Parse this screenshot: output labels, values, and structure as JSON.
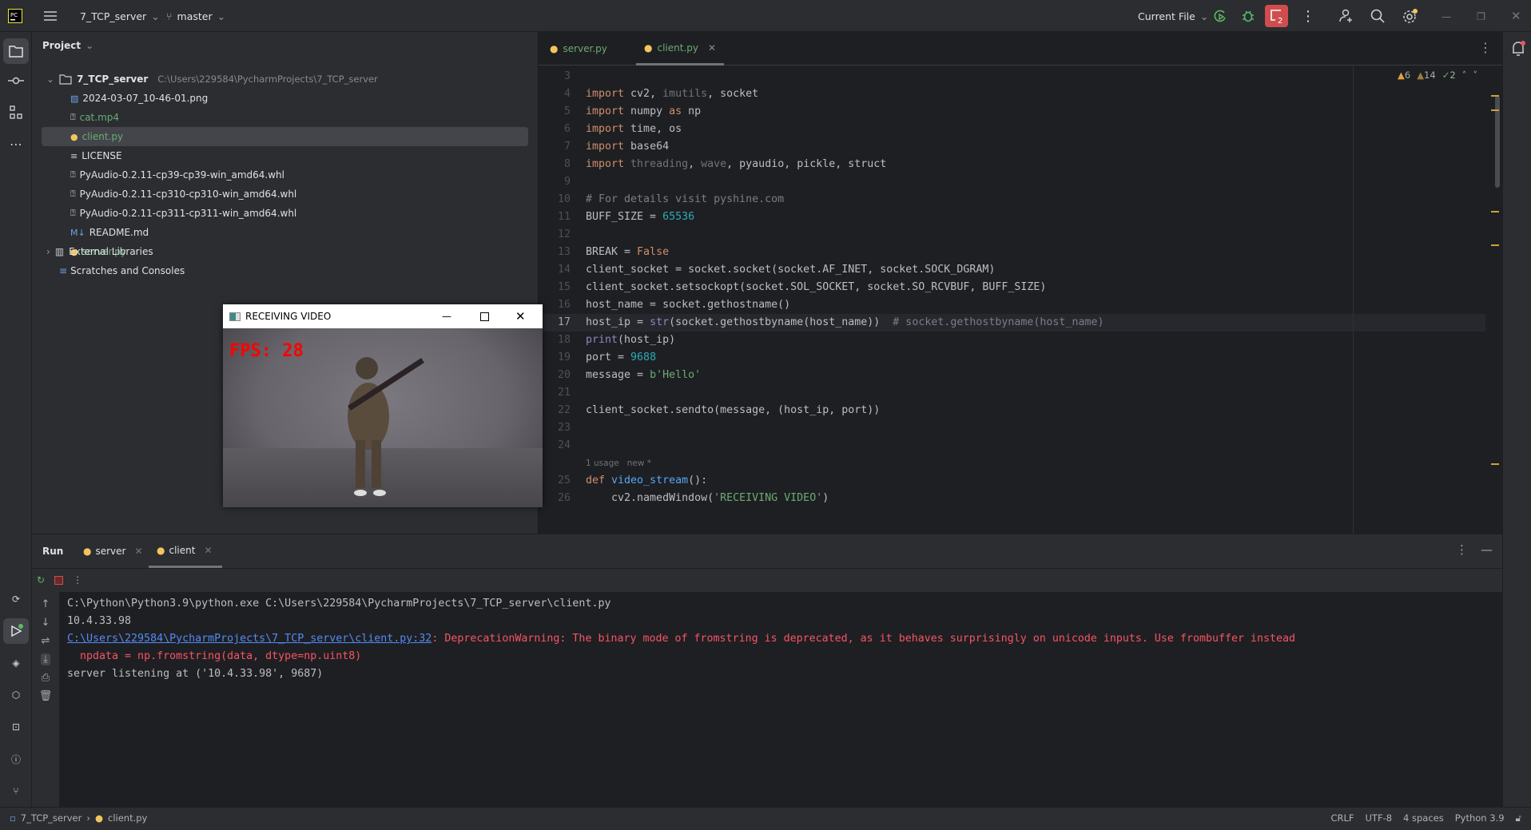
{
  "titlebar": {
    "project": "7_TCP_server",
    "branch": "master",
    "run_config": "Current File",
    "badge_count": "2"
  },
  "project": {
    "header": "Project",
    "root": "7_TCP_server",
    "root_path": "C:\\Users\\229584\\PycharmProjects\\7_TCP_server",
    "files": [
      {
        "name": "2024-03-07_10-46-01.png",
        "icon": "image-icon",
        "color": "#dfe1e5"
      },
      {
        "name": "cat.mp4",
        "icon": "unknown-file-icon",
        "color": "#6aab73"
      },
      {
        "name": "client.py",
        "icon": "python-icon",
        "color": "#6aab73",
        "selected": true
      },
      {
        "name": "LICENSE",
        "icon": "text-file-icon",
        "color": "#dfe1e5"
      },
      {
        "name": "PyAudio-0.2.11-cp39-cp39-win_amd64.whl",
        "icon": "unknown-file-icon",
        "color": "#dfe1e5"
      },
      {
        "name": "PyAudio-0.2.11-cp310-cp310-win_amd64.whl",
        "icon": "unknown-file-icon",
        "color": "#dfe1e5"
      },
      {
        "name": "PyAudio-0.2.11-cp311-cp311-win_amd64.whl",
        "icon": "unknown-file-icon",
        "color": "#dfe1e5"
      },
      {
        "name": "README.md",
        "icon": "markdown-icon",
        "color": "#dfe1e5"
      },
      {
        "name": "server.py",
        "icon": "python-icon",
        "color": "#6aab73"
      }
    ],
    "external": "External Libraries",
    "scratches": "Scratches and Consoles"
  },
  "editor": {
    "tabs": [
      {
        "label": "server.py"
      },
      {
        "label": "client.py",
        "active": true
      }
    ],
    "inspections": {
      "warnings": "6",
      "weak_warnings": "14",
      "typos": "2"
    },
    "current_line": "17",
    "inlay_hint": "1 usage   new *",
    "lines": [
      {
        "n": "3",
        "t": []
      },
      {
        "n": "4",
        "t": [
          [
            "import ",
            "kw"
          ],
          [
            "cv2, ",
            "tx"
          ],
          [
            "imutils",
            "un"
          ],
          [
            ", socket",
            "tx"
          ]
        ]
      },
      {
        "n": "5",
        "t": [
          [
            "import ",
            "kw"
          ],
          [
            "numpy ",
            "tx"
          ],
          [
            "as ",
            "kw"
          ],
          [
            "np",
            "tx"
          ]
        ]
      },
      {
        "n": "6",
        "t": [
          [
            "import ",
            "kw"
          ],
          [
            "time, os",
            "tx"
          ]
        ]
      },
      {
        "n": "7",
        "t": [
          [
            "import ",
            "kw"
          ],
          [
            "base64",
            "tx"
          ]
        ]
      },
      {
        "n": "8",
        "t": [
          [
            "import ",
            "kw"
          ],
          [
            "threading",
            "un"
          ],
          [
            ", ",
            "tx"
          ],
          [
            "wave",
            "un"
          ],
          [
            ", pyaudio, pickle, struct",
            "tx"
          ]
        ]
      },
      {
        "n": "9",
        "t": []
      },
      {
        "n": "10",
        "t": [
          [
            "# For details visit pyshine.com",
            "cm"
          ]
        ]
      },
      {
        "n": "11",
        "t": [
          [
            "BUFF_SIZE = ",
            "tx"
          ],
          [
            "65536",
            "num"
          ]
        ]
      },
      {
        "n": "12",
        "t": []
      },
      {
        "n": "13",
        "t": [
          [
            "BREAK = ",
            "tx"
          ],
          [
            "False",
            "kw"
          ]
        ]
      },
      {
        "n": "14",
        "t": [
          [
            "client_socket = socket.socket(socket.AF_INET, socket.SOCK_DGRAM)",
            "tx"
          ]
        ]
      },
      {
        "n": "15",
        "t": [
          [
            "client_socket.setsockopt(socket.SOL_SOCKET, socket.SO_RCVBUF, BUFF_SIZE)",
            "tx"
          ]
        ]
      },
      {
        "n": "16",
        "t": [
          [
            "host_name = socket.gethostname()",
            "tx"
          ]
        ]
      },
      {
        "n": "17",
        "t": [
          [
            "host_ip = ",
            "tx"
          ],
          [
            "str",
            "bi"
          ],
          [
            "(socket.gethostbyname(host_name))  ",
            "tx"
          ],
          [
            "# socket.gethostbyname(host_name)",
            "cm"
          ]
        ]
      },
      {
        "n": "18",
        "t": [
          [
            "print",
            "bi"
          ],
          [
            "(host_ip)",
            "tx"
          ]
        ]
      },
      {
        "n": "19",
        "t": [
          [
            "port = ",
            "tx"
          ],
          [
            "9688",
            "num"
          ]
        ]
      },
      {
        "n": "20",
        "t": [
          [
            "message = ",
            "tx"
          ],
          [
            "b'Hello'",
            "str"
          ]
        ]
      },
      {
        "n": "21",
        "t": []
      },
      {
        "n": "22",
        "t": [
          [
            "client_socket.sendto(message, (host_ip, port))",
            "tx"
          ]
        ]
      },
      {
        "n": "23",
        "t": []
      },
      {
        "n": "24",
        "t": []
      },
      {
        "n": "25",
        "t": [
          [
            "def ",
            "kw"
          ],
          [
            "video_stream",
            "fn"
          ],
          [
            "():",
            "tx"
          ]
        ]
      },
      {
        "n": "26",
        "t": [
          [
            "    cv2.namedWindow(",
            "tx"
          ],
          [
            "'RECEIVING VIDEO'",
            "str"
          ],
          [
            ")",
            "tx"
          ]
        ]
      }
    ]
  },
  "video_window": {
    "title": "RECEIVING VIDEO",
    "fps_label": "FPS: 28"
  },
  "run": {
    "title": "Run",
    "tabs": [
      {
        "label": "server"
      },
      {
        "label": "client",
        "active": true
      }
    ],
    "console": {
      "cmd": "C:\\Python\\Python3.9\\python.exe C:\\Users\\229584\\PycharmProjects\\7_TCP_server\\client.py",
      "ip": "10.4.33.98",
      "warn_link": "C:\\Users\\229584\\PycharmProjects\\7_TCP_server\\client.py:32",
      "warn_text": ": DeprecationWarning: The binary mode of fromstring is deprecated, as it behaves surprisingly on unicode inputs. Use frombuffer instead",
      "warn_code": "  npdata = np.fromstring(data, dtype=np.uint8)",
      "listen": "server listening at ('10.4.33.98', 9687)"
    }
  },
  "status": {
    "breadcrumb": [
      "7_TCP_server",
      "client.py"
    ],
    "line_sep": "CRLF",
    "encoding": "UTF-8",
    "indent": "4 spaces",
    "interpreter": "Python 3.9"
  }
}
